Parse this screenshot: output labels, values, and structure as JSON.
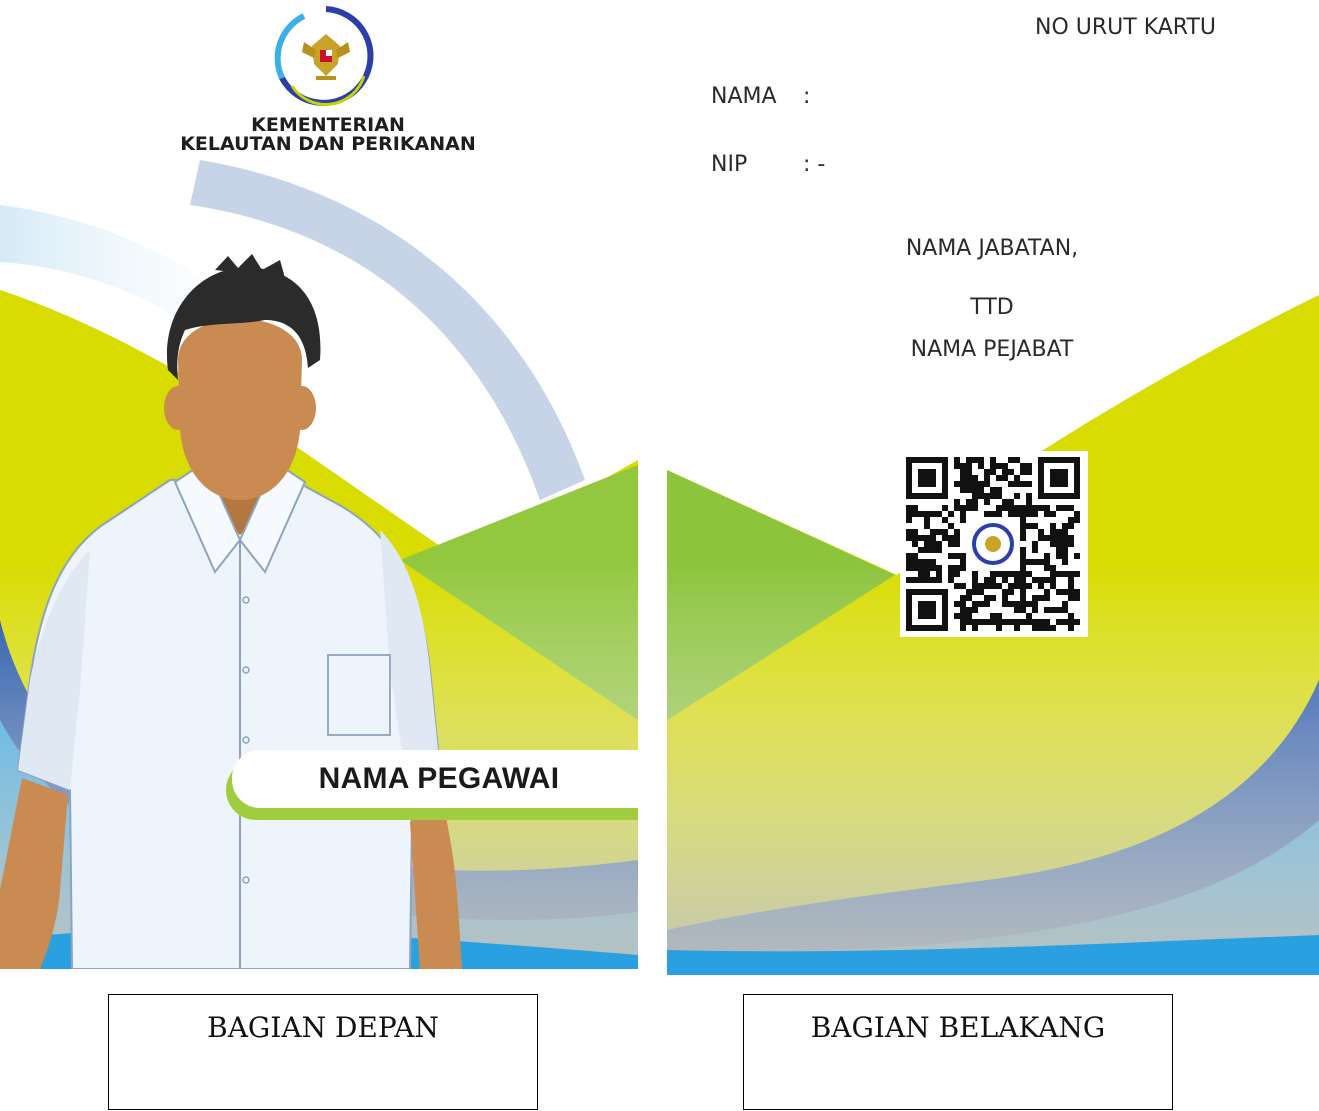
{
  "front": {
    "org_name_line1": "KEMENTERIAN",
    "org_name_line2": "KELAUTAN DAN PERIKANAN",
    "employee_name": "NAMA PEGAWAI",
    "logo_icon": "garuda-emblem-icon",
    "caption": "BAGIAN DEPAN"
  },
  "back": {
    "card_number_label": "NO URUT KARTU",
    "name_label": "NAMA",
    "name_separator": ":",
    "nip_label": "NIP",
    "nip_value": ": -",
    "position_title": "NAMA JABATAN,",
    "signature": "TTD",
    "official_name": "NAMA PEJABAT",
    "qr_icon": "qr-code-icon",
    "caption": "BAGIAN BELAKANG"
  },
  "colors": {
    "lime": "#d8dc00",
    "green": "#8cc43c",
    "blue_dark": "#1a4fa8",
    "blue_light": "#2aa0e0",
    "grey_fade": "#c7c9c4",
    "arc_blue": "#c5d1e6"
  }
}
